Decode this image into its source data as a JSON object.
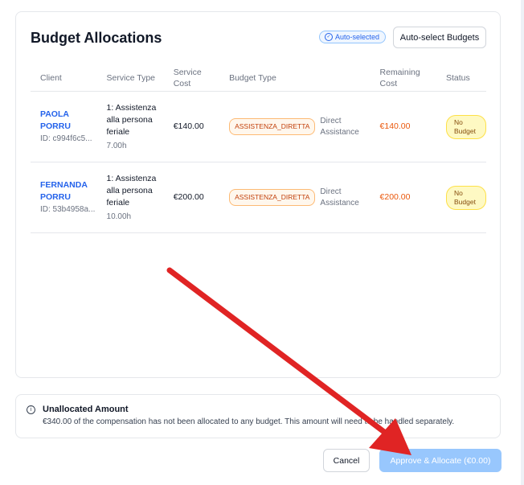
{
  "card": {
    "title": "Budget Allocations",
    "auto_badge": "Auto-selected",
    "auto_button": "Auto-select Budgets"
  },
  "table": {
    "headers": {
      "client": "Client",
      "service_type": "Service Type",
      "service_cost": "Service Cost",
      "budget_type": "Budget Type",
      "remaining_cost": "Remaining Cost",
      "status": "Status"
    },
    "rows": [
      {
        "client_name": "PAOLA PORRU",
        "client_id": "ID: c994f6c5...",
        "service": "1: Assistenza alla persona feriale",
        "hours": "7.00h",
        "cost": "€140.00",
        "budget_tag": "ASSISTENZA_DIRETTA",
        "budget_label": "Direct Assistance",
        "remaining": "€140.00",
        "status": "No Budget"
      },
      {
        "client_name": "FERNANDA PORRU",
        "client_id": "ID: 53b4958a...",
        "service": "1: Assistenza alla persona feriale",
        "hours": "10.00h",
        "cost": "€200.00",
        "budget_tag": "ASSISTENZA_DIRETTA",
        "budget_label": "Direct Assistance",
        "remaining": "€200.00",
        "status": "No Budget"
      }
    ]
  },
  "notice": {
    "title": "Unallocated Amount",
    "text": "€340.00 of the compensation has not been allocated to any budget. This amount will need to be handled separately."
  },
  "footer": {
    "cancel": "Cancel",
    "approve": "Approve & Allocate (€0.00)"
  },
  "colors": {
    "accent": "#2563eb",
    "annotation_arrow": "#e02424"
  },
  "icons": [
    "check-circle-icon",
    "info-icon"
  ]
}
